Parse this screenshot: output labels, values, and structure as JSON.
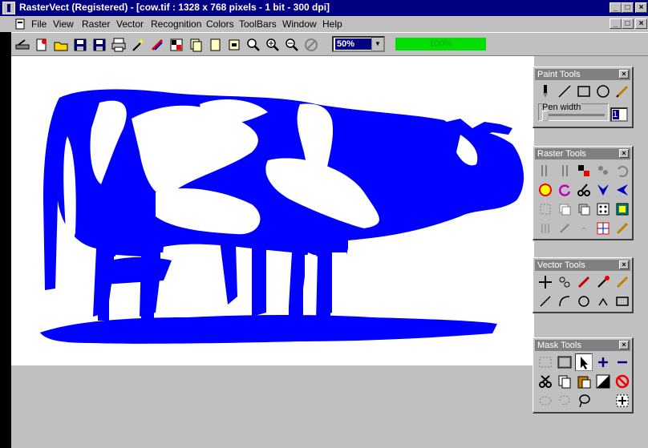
{
  "window": {
    "title": "RasterVect (Registered) - [cow.tif : 1328 x 768 pixels - 1 bit - 300 dpi]",
    "minimize": "_",
    "maximize": "□",
    "close": "×"
  },
  "menu": [
    "File",
    "View",
    "Raster",
    "Vector",
    "Recognition",
    "Colors",
    "ToolBars",
    "Window",
    "Help"
  ],
  "toolbar": {
    "zoom_value": "50%",
    "progress_text": "100%",
    "progress_fraction": 1.0
  },
  "palettes": {
    "paint": {
      "title": "Paint Tools",
      "pen_width_label": "Pen width",
      "pen_width_value": "1"
    },
    "raster": {
      "title": "Raster Tools"
    },
    "vector": {
      "title": "Vector Tools"
    },
    "mask": {
      "title": "Mask Tools"
    }
  },
  "close_glyph": "×",
  "colors": {
    "titlebar": "#000080",
    "image_ink": "#0000ff",
    "face": "#c0c0c0",
    "progress": "#00e000"
  }
}
